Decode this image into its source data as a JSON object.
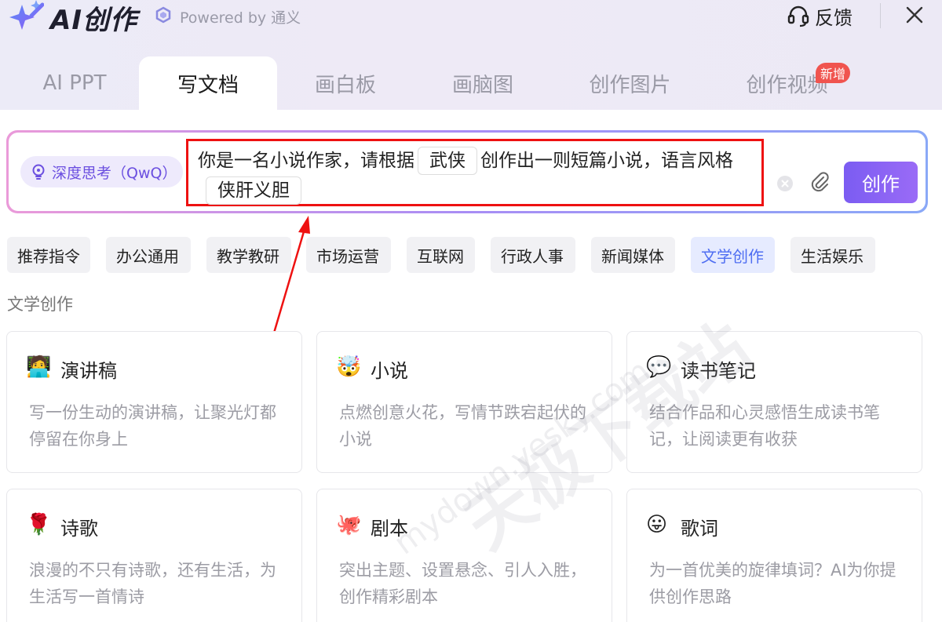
{
  "header": {
    "app_title": "AI创作",
    "powered_by": "Powered by 通义",
    "feedback_label": "反馈"
  },
  "tabs": [
    {
      "label": "AI PPT"
    },
    {
      "label": "写文档",
      "active": true
    },
    {
      "label": "画白板"
    },
    {
      "label": "画脑图"
    },
    {
      "label": "创作图片"
    },
    {
      "label": "创作视频",
      "badge": "新增"
    }
  ],
  "input": {
    "deep_think_label": "深度思考（QwQ）",
    "prompt_part1": "你是一名小说作家，请根据",
    "slot1": "武侠",
    "prompt_part2": "创作出一则短篇小说，语言风格",
    "slot2": "侠肝义胆",
    "create_label": "创作"
  },
  "categories": [
    {
      "label": "推荐指令"
    },
    {
      "label": "办公通用"
    },
    {
      "label": "教学教研"
    },
    {
      "label": "市场运营"
    },
    {
      "label": "互联网"
    },
    {
      "label": "行政人事"
    },
    {
      "label": "新闻媒体"
    },
    {
      "label": "文学创作",
      "active": true
    },
    {
      "label": "生活娱乐"
    }
  ],
  "section_title": "文学创作",
  "cards": [
    {
      "emoji": "🧑‍💻",
      "title": "演讲稿",
      "desc": "写一份生动的演讲稿，让聚光灯都停留在你身上"
    },
    {
      "emoji": "🤯",
      "title": "小说",
      "desc": "点燃创意火花，写情节跌宕起伏的小说"
    },
    {
      "emoji": "💬",
      "title": "读书笔记",
      "desc": "结合作品和心灵感悟生成读书笔记，让阅读更有收获"
    },
    {
      "emoji": "🌹",
      "title": "诗歌",
      "desc": "浪漫的不只有诗歌，还有生活，为生活写一首情诗"
    },
    {
      "emoji": "🐙",
      "title": "剧本",
      "desc": "突出主题、设置悬念、引人入胜，创作精彩剧本"
    },
    {
      "emoji": "😛",
      "title": "歌词",
      "desc": "为一首优美的旋律填词？AI为你提供创作思路"
    }
  ],
  "watermark": {
    "text": "天极下载站",
    "url": "mydown.yesky.com"
  },
  "colors": {
    "accent": "#7b5cf2",
    "annotation_red": "#e11"
  }
}
